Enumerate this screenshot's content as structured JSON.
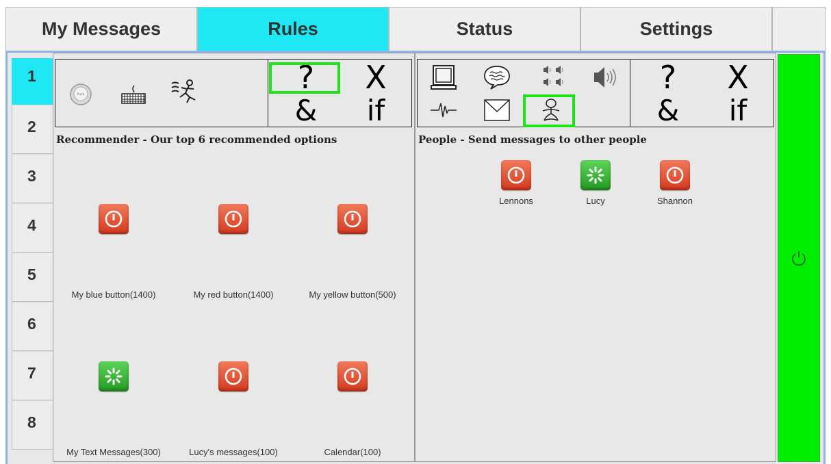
{
  "tabs": [
    {
      "label": "My Messages",
      "active": false
    },
    {
      "label": "Rules",
      "active": true
    },
    {
      "label": "Status",
      "active": false
    },
    {
      "label": "Settings",
      "active": false
    }
  ],
  "side_tabs": [
    "1",
    "2",
    "3",
    "4",
    "5",
    "6",
    "7",
    "8"
  ],
  "active_side_tab": "1",
  "toolbar_ops": {
    "question": "?",
    "cross": "X",
    "and": "&",
    "if": "if"
  },
  "left_panel": {
    "title": "Recommender - Our top 6 recommended options",
    "items": [
      {
        "label": "My blue button(1400)",
        "color": "red",
        "icon": "power-icon"
      },
      {
        "label": "My red button(1400)",
        "color": "red",
        "icon": "power-icon"
      },
      {
        "label": "My yellow button(500)",
        "color": "red",
        "icon": "power-icon"
      },
      {
        "label": "My Text Messages(300)",
        "color": "green",
        "icon": "spinner-icon"
      },
      {
        "label": "Lucy's messages(100)",
        "color": "red",
        "icon": "power-icon"
      },
      {
        "label": "Calendar(100)",
        "color": "red",
        "icon": "power-icon"
      }
    ]
  },
  "right_panel": {
    "title": "People - Send messages to other people",
    "people": [
      {
        "label": "Lennons",
        "color": "red",
        "icon": "power-icon"
      },
      {
        "label": "Lucy",
        "color": "green",
        "icon": "spinner-icon"
      },
      {
        "label": "Shannon",
        "color": "red",
        "icon": "power-icon"
      }
    ]
  },
  "colors": {
    "active_tab": "#1ee8f4",
    "highlight": "#22e01c",
    "power_bar": "#00ee00",
    "frame_border": "#8fb2e6"
  }
}
